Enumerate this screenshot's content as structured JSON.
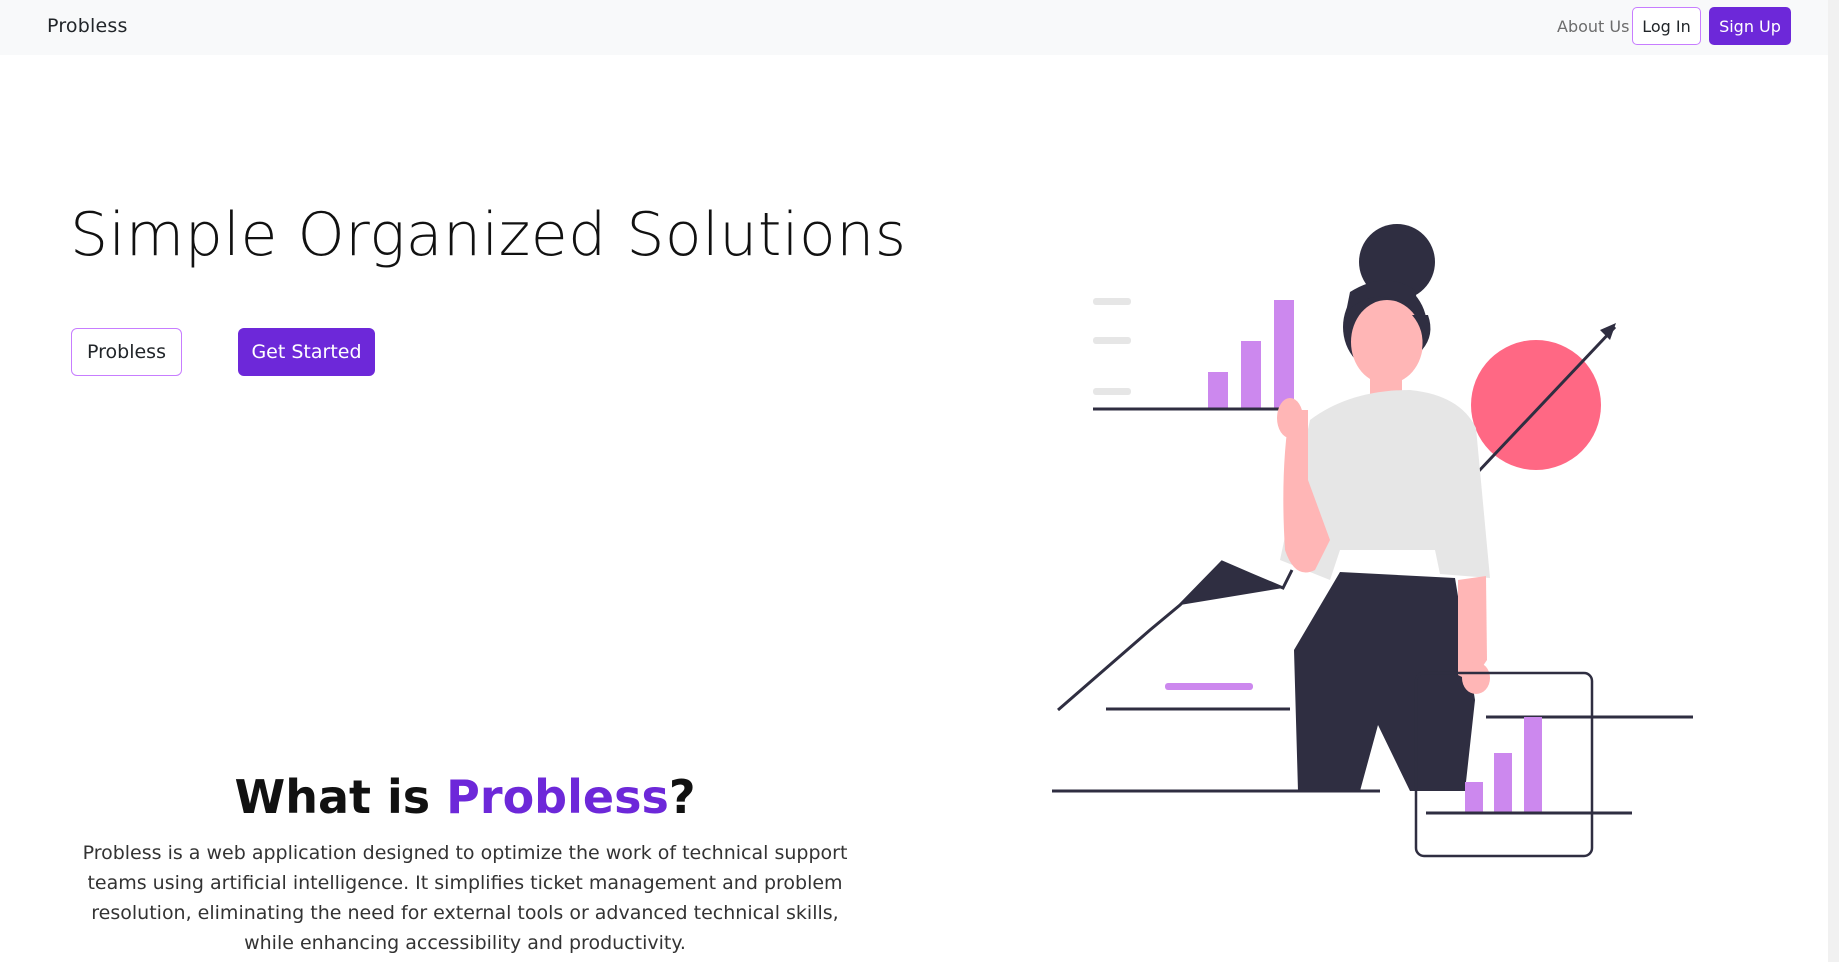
{
  "navbar": {
    "brand": "Probless",
    "about_label": "About Us",
    "login_label": "Log In",
    "signup_label": "Sign Up"
  },
  "hero": {
    "title": "Simple Organized Solutions",
    "outline_button_label": "Probless",
    "primary_button_label": "Get Started"
  },
  "about": {
    "heading_prefix": "What is ",
    "heading_accent": "Probless",
    "heading_suffix": "?",
    "description": "Probless is a web application designed to optimize the work of technical support teams using artificial intelligence. It simplifies ticket management and problem resolution, eliminating the need for external tools or advanced technical skills, while enhancing accessibility and productivity."
  },
  "colors": {
    "accent": "#6d28d9",
    "accent_light": "#c77dff",
    "chart_bar": "#cc88ee",
    "circle": "#ff6884",
    "dark": "#2f2e41"
  }
}
